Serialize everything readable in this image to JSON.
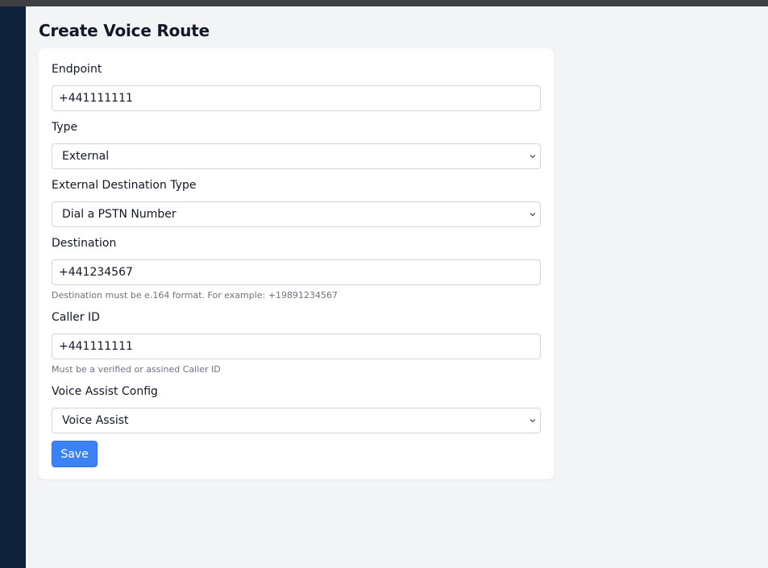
{
  "page": {
    "title": "Create Voice Route"
  },
  "form": {
    "endpoint": {
      "label": "Endpoint",
      "value": "+441111111"
    },
    "type": {
      "label": "Type",
      "value": "External"
    },
    "external_destination_type": {
      "label": "External Destination Type",
      "value": "Dial a PSTN Number"
    },
    "destination": {
      "label": "Destination",
      "value": "+441234567",
      "help": "Destination must be e.164 format. For example: +19891234567"
    },
    "caller_id": {
      "label": "Caller ID",
      "value": "+441111111",
      "help": "Must be a verified or assined Caller ID"
    },
    "voice_assist_config": {
      "label": "Voice Assist Config",
      "value": "Voice Assist"
    },
    "save_label": "Save"
  },
  "colors": {
    "sidebar": "#0f213a",
    "background": "#f3f4f6",
    "primary_button": "#3b82f6"
  },
  "icons": {
    "select_chevron": "chevron-down-icon"
  }
}
